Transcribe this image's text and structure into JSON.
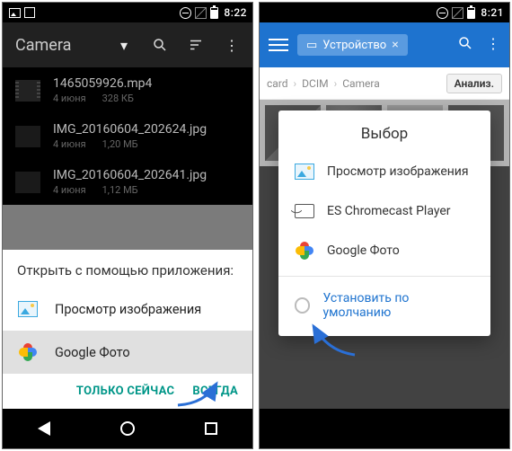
{
  "left": {
    "status_time": "8:22",
    "appbar_title": "Camera",
    "files": [
      {
        "name": "1465059926.mp4",
        "date": "4 июня",
        "size": "328 КБ"
      },
      {
        "name": "IMG_20160604_202624.jpg",
        "date": "4 июня",
        "size": "1,20 МБ"
      },
      {
        "name": "IMG_20160604_202641.jpg",
        "date": "4 июня",
        "size": "1,12 МБ"
      }
    ],
    "sheet_title": "Открыть с помощью приложения:",
    "sheet_items": [
      {
        "label": "Просмотр изображения"
      },
      {
        "label": "Google Фото"
      }
    ],
    "btn_once": "ТОЛЬКО СЕЙЧАС",
    "btn_always": "ВСЕГДА"
  },
  "right": {
    "status_time": "8:21",
    "crumb_pill": "Устройство",
    "breadcrumbs": [
      "card",
      "DCIM",
      "Camera"
    ],
    "bc_action": "Анализ.",
    "dialog_title": "Выбор",
    "dialog_items": [
      {
        "label": "Просмотр изображения"
      },
      {
        "label": "ES Chromecast Player"
      },
      {
        "label": "Google Фото"
      }
    ],
    "default_label": "Установить по умолчанию"
  }
}
